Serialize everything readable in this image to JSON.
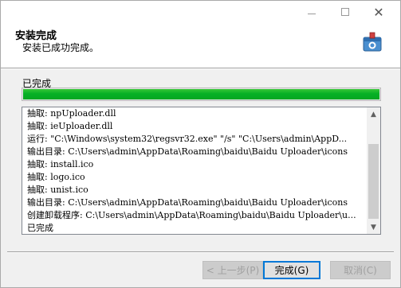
{
  "window": {
    "heading": "安装完成",
    "subheading": "安装已成功完成。",
    "controls": {
      "minimize_icon": "minimize-icon",
      "maximize_icon": "maximize-icon",
      "close_label": "✕"
    },
    "logo_icon": "package-logo-icon"
  },
  "progress": {
    "status_label": "已完成",
    "value": 1.0,
    "color": "#06b025"
  },
  "log": {
    "lines": [
      "抽取: npUploader.dll",
      "抽取: ieUploader.dll",
      "运行: \"C:\\Windows\\system32\\regsvr32.exe\"  \"/s\" \"C:\\Users\\admin\\AppD...",
      "输出目录: C:\\Users\\admin\\AppData\\Roaming\\baidu\\Baidu Uploader\\icons",
      "抽取: install.ico",
      "抽取: logo.ico",
      "抽取: unist.ico",
      "输出目录: C:\\Users\\admin\\AppData\\Roaming\\baidu\\Baidu Uploader\\icons",
      "创建卸载程序: C:\\Users\\admin\\AppData\\Roaming\\baidu\\Baidu Uploader\\u...",
      "已完成"
    ],
    "scroll_up_icon": "▲",
    "scroll_down_icon": "▼"
  },
  "buttons": {
    "back_label": "< 上一步(P)",
    "finish_label": "完成(G)",
    "cancel_label": "取消(C)"
  }
}
